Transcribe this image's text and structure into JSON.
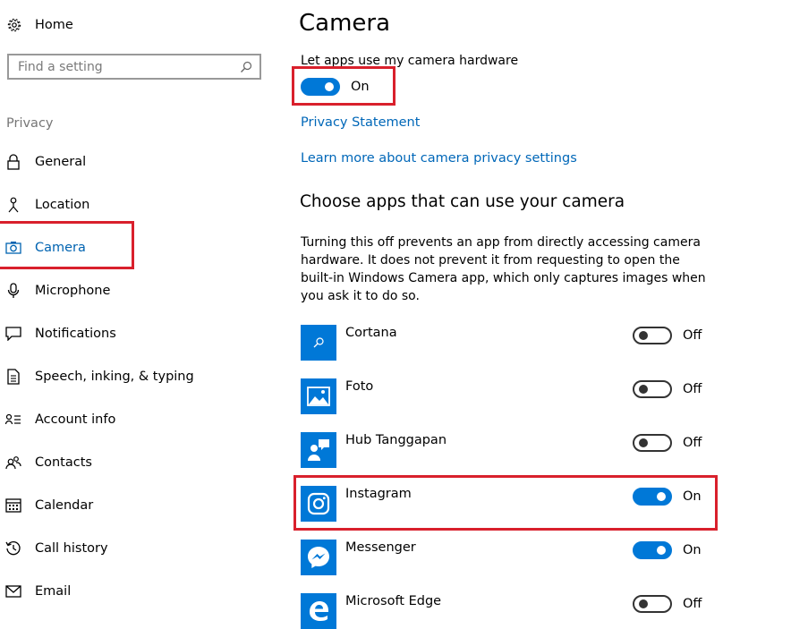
{
  "sidebar": {
    "home_label": "Home",
    "search_placeholder": "Find a setting",
    "section_label": "Privacy",
    "items": [
      {
        "label": "General",
        "icon": "lock-icon"
      },
      {
        "label": "Location",
        "icon": "location-icon"
      },
      {
        "label": "Camera",
        "icon": "camera-icon",
        "active": true
      },
      {
        "label": "Microphone",
        "icon": "microphone-icon"
      },
      {
        "label": "Notifications",
        "icon": "notifications-icon"
      },
      {
        "label": "Speech, inking, & typing",
        "icon": "speech-icon"
      },
      {
        "label": "Account info",
        "icon": "account-info-icon"
      },
      {
        "label": "Contacts",
        "icon": "contacts-icon"
      },
      {
        "label": "Calendar",
        "icon": "calendar-icon"
      },
      {
        "label": "Call history",
        "icon": "call-history-icon"
      },
      {
        "label": "Email",
        "icon": "email-icon"
      }
    ]
  },
  "main": {
    "title": "Camera",
    "hardware_label": "Let apps use my camera hardware",
    "hardware_toggle": {
      "state": "On",
      "on": true
    },
    "privacy_link": "Privacy Statement",
    "learn_more_link": "Learn more about camera privacy settings",
    "section_title": "Choose apps that can use your camera",
    "description": "Turning this off prevents an app from directly accessing camera hardware. It does not prevent it from requesting to open the built-in Windows Camera app, which only captures images when you ask it to do so.",
    "apps": [
      {
        "name": "Cortana",
        "state": "Off",
        "on": false,
        "icon": "cortana-icon"
      },
      {
        "name": "Foto",
        "state": "Off",
        "on": false,
        "icon": "photos-icon"
      },
      {
        "name": "Hub Tanggapan",
        "state": "Off",
        "on": false,
        "icon": "feedback-hub-icon"
      },
      {
        "name": "Instagram",
        "state": "On",
        "on": true,
        "icon": "instagram-icon"
      },
      {
        "name": "Messenger",
        "state": "On",
        "on": true,
        "icon": "messenger-icon"
      },
      {
        "name": "Microsoft Edge",
        "state": "Off",
        "on": false,
        "icon": "edge-icon"
      }
    ]
  },
  "colors": {
    "accent": "#0078d7",
    "link": "#0067b8",
    "highlight": "#d9202c",
    "muted": "#767676"
  }
}
